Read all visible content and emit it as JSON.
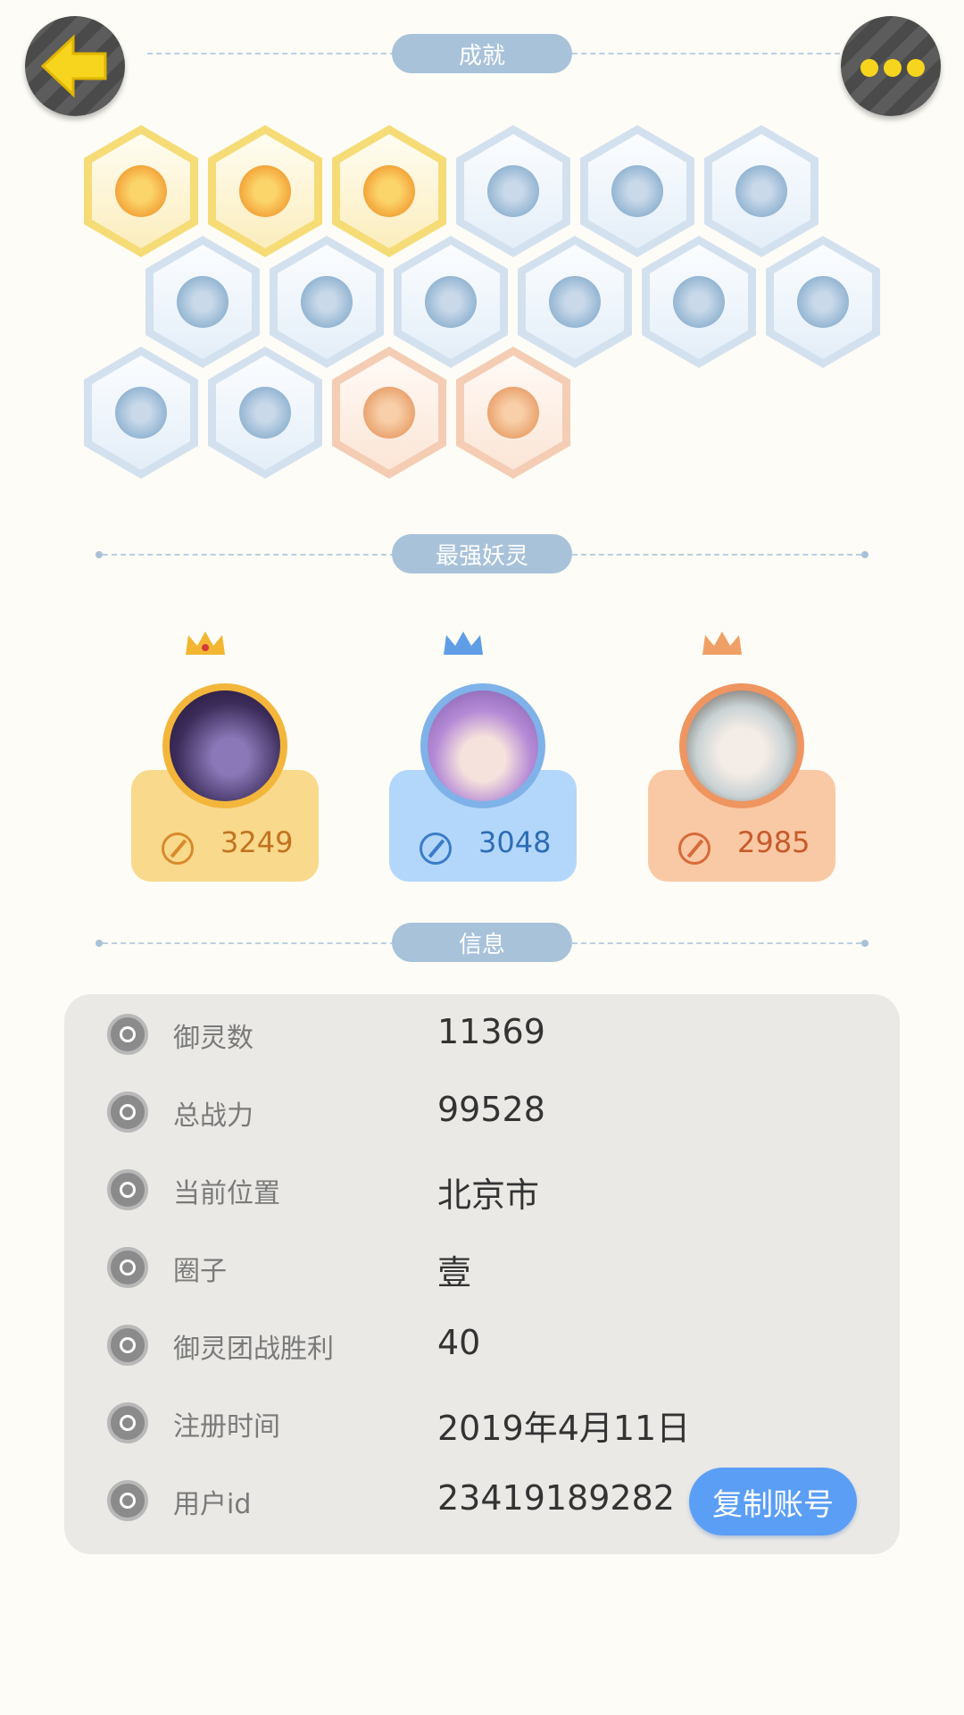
{
  "header": {
    "back_icon": "back-arrow-icon",
    "more_icon": "more-dots-icon",
    "back_color": "#f7d51e"
  },
  "sections": {
    "achievements": "成就",
    "top_spirits": "最强妖灵",
    "info": "信息"
  },
  "achievements": [
    {
      "tier": "gold"
    },
    {
      "tier": "gold"
    },
    {
      "tier": "gold"
    },
    {
      "tier": "blue"
    },
    {
      "tier": "blue"
    },
    {
      "tier": "blue"
    },
    {
      "tier": "blue"
    },
    {
      "tier": "blue"
    },
    {
      "tier": "blue"
    },
    {
      "tier": "blue"
    },
    {
      "tier": "blue"
    },
    {
      "tier": "blue"
    },
    {
      "tier": "blue"
    },
    {
      "tier": "blue"
    },
    {
      "tier": "peach"
    },
    {
      "tier": "peach"
    }
  ],
  "top_spirits": [
    {
      "rank": 1,
      "power": "3249",
      "theme": "gold"
    },
    {
      "rank": 2,
      "power": "3048",
      "theme": "blue"
    },
    {
      "rank": 3,
      "power": "2985",
      "theme": "peach"
    }
  ],
  "info": {
    "rows": [
      {
        "label": "御灵数",
        "value": "11369",
        "icon": "spirit-count-icon"
      },
      {
        "label": "总战力",
        "value": "99528",
        "icon": "sword-icon"
      },
      {
        "label": "当前位置",
        "value": "北京市",
        "icon": "location-pin-icon"
      },
      {
        "label": "圈子",
        "value": "壹",
        "icon": "circle-target-icon"
      },
      {
        "label": "御灵团战胜利",
        "value": "40",
        "icon": "team-battle-icon"
      },
      {
        "label": "注册时间",
        "value": "2019年4月11日",
        "icon": "clock-icon"
      },
      {
        "label": "用户id",
        "value": "23419189282",
        "icon": "id-card-icon"
      }
    ],
    "copy_button": "复制账号"
  }
}
